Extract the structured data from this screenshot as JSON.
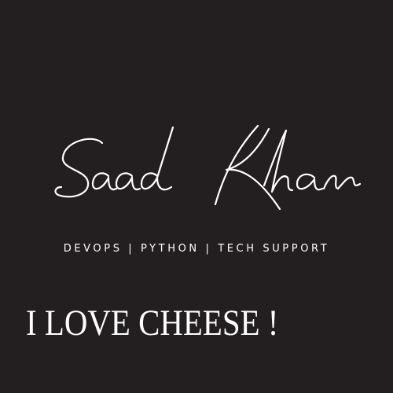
{
  "logo": {
    "signature_text": "Saad Khan",
    "color": "#ffffff"
  },
  "tagline": "DEVOPS | PYTHON | TECH SUPPORT",
  "headline": "I LOVE CHEESE !",
  "colors": {
    "background": "#231f20",
    "text": "#ffffff"
  }
}
